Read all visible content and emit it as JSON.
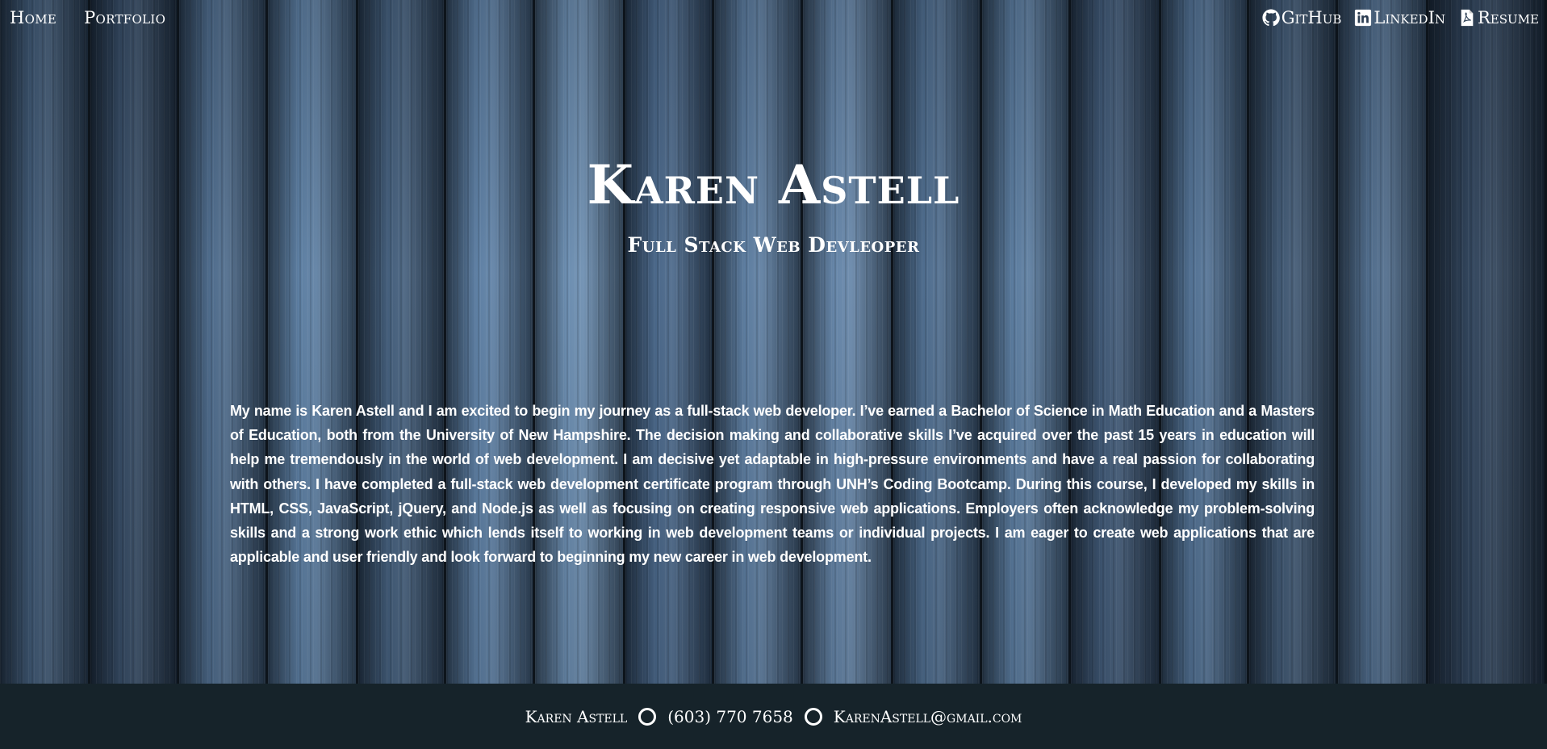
{
  "nav": {
    "left": [
      {
        "label": "Home"
      },
      {
        "label": "Portfolio"
      }
    ],
    "right": [
      {
        "label": "GitHub",
        "icon": "github-icon"
      },
      {
        "label": "LinkedIn",
        "icon": "linkedin-icon"
      },
      {
        "label": "Resume",
        "icon": "pdf-file-icon"
      }
    ]
  },
  "hero": {
    "name": "Karen Astell",
    "subtitle": "Full Stack Web Devleoper",
    "bio": "My name is Karen Astell and I am excited to begin my journey as a full-stack web developer. I’ve earned a Bachelor of Science in Math Education and a Masters of Education, both from the University of New Hampshire. The decision making and collaborative skills I’ve acquired over the past 15 years in education will help me tremendously in the world of web development. I am decisive yet adaptable in high-pressure environments and have a real passion for collaborating with others. I have completed a full-stack web development certificate program through UNH’s Coding Bootcamp. During this course, I developed my skills in HTML, CSS, JavaScript, jQuery, and Node.js as well as focusing on creating responsive web applications. Employers often acknowledge my problem-solving skills and a strong work ethic which lends itself to working in web development teams or individual projects. I am eager to create web applications that are applicable and user friendly and look forward to beginning my new career in web development."
  },
  "footer": {
    "name": "Karen Astell",
    "phone": "(603) 770 7658",
    "email": "KarenAstell@gmail.com"
  },
  "colors": {
    "footer_bg": "#16232a",
    "text": "#ffffff",
    "wood_blue": "#4a6a8c"
  }
}
